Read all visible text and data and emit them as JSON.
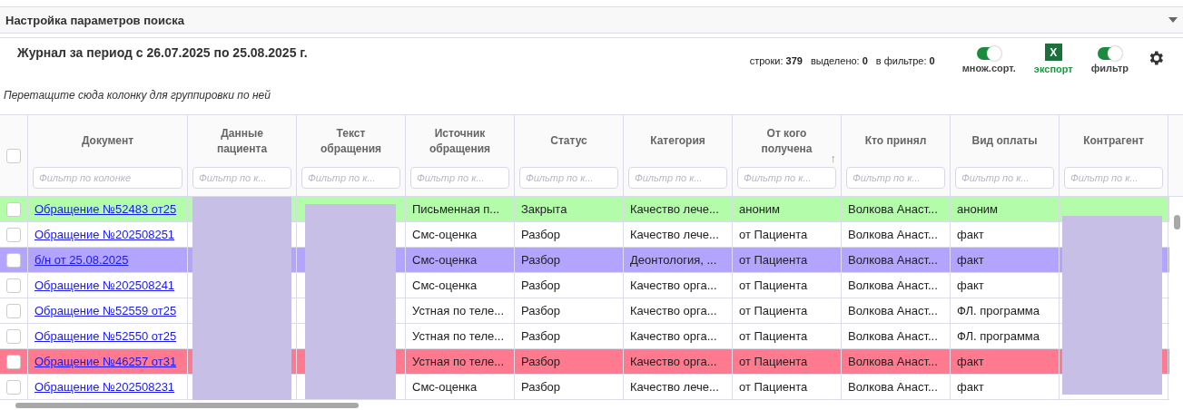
{
  "search_panel": {
    "title": "Настройка параметров поиска",
    "expanded": false
  },
  "journal": {
    "title": "Журнал за период с 26.07.2025 по 25.08.2025 г.",
    "stats": [
      {
        "label": "строки:",
        "value": "379"
      },
      {
        "label": "выделено:",
        "value": "0"
      },
      {
        "label": "в фильтре:",
        "value": "0"
      }
    ],
    "toggles": [
      {
        "label": "множ.сорт.",
        "on": true
      },
      {
        "kind": "export",
        "label": "экспорт",
        "icon_text": "X"
      },
      {
        "label": "фильтр",
        "on": true
      }
    ],
    "group_hint": "Перетащите сюда колонку для группировки по ней"
  },
  "table": {
    "select_all_checked": false,
    "columns": [
      {
        "title": "Документ",
        "filter_placeholder": "Фильтр по колонке",
        "kind": "link"
      },
      {
        "title": "Данные пациента",
        "filter_placeholder": "Фильтр по к..."
      },
      {
        "title": "Текст обращения",
        "filter_placeholder": "Фильтр по к..."
      },
      {
        "title": "Источник обращения",
        "filter_placeholder": "Фильтр по к..."
      },
      {
        "title": "Статус",
        "filter_placeholder": "Фильтр по к..."
      },
      {
        "title": "Категория",
        "filter_placeholder": "Фильтр по к..."
      },
      {
        "title": "От кого получена",
        "filter_placeholder": "Фильтр по к...",
        "sort_indicator": "↑"
      },
      {
        "title": "Кто принял",
        "filter_placeholder": "Фильтр по к..."
      },
      {
        "title": "Вид оплаты",
        "filter_placeholder": "Фильтр по к..."
      },
      {
        "title": "Контрагент",
        "filter_placeholder": "Фильтр по к..."
      }
    ],
    "rows": [
      {
        "checked": false,
        "color": "#b3fcaa",
        "cells": [
          "Обращение №52483 от25",
          "",
          "",
          "Письменная п...",
          "Закрыта",
          "Качество лече...",
          "аноним",
          "Волкова Анаст...",
          "аноним",
          ""
        ]
      },
      {
        "checked": false,
        "color": "#ffffff",
        "cells": [
          "Обращение №202508251",
          "",
          "",
          "Смс-оценка",
          "Разбор",
          "Качество лече...",
          "от Пациента",
          "Волкова Анаст...",
          "факт",
          ""
        ]
      },
      {
        "checked": false,
        "color": "#b3a4ff",
        "cells": [
          "б/н от 25.08.2025",
          "",
          "",
          "Смс-оценка",
          "Разбор",
          "Деонтология, ...",
          "от Пациента",
          "Волкова Анаст...",
          "факт",
          ""
        ]
      },
      {
        "checked": false,
        "color": "#ffffff",
        "cells": [
          "Обращение №202508241",
          "",
          "",
          "Смс-оценка",
          "Разбор",
          "Качество орга...",
          "от Пациента",
          "Волкова Анаст...",
          "факт",
          ""
        ]
      },
      {
        "checked": false,
        "color": "#ffffff",
        "cells": [
          "Обращение №52559 от25",
          "",
          "",
          "Устная по теле...",
          "Разбор",
          "Качество орга...",
          "от Пациента",
          "Волкова Анаст...",
          "ФЛ. программа",
          ""
        ]
      },
      {
        "checked": false,
        "color": "#ffffff",
        "cells": [
          "Обращение №52550 от25",
          "",
          "",
          "Устная по теле...",
          "Разбор",
          "Качество орга...",
          "от Пациента",
          "Волкова Анаст...",
          "ФЛ. программа",
          ""
        ]
      },
      {
        "checked": false,
        "color": "#ff7a8f",
        "cells": [
          "Обращение №46257 от31",
          "",
          "",
          "Устная по теле...",
          "Разбор",
          "Качество орга...",
          "от Пациента",
          "Волкова Анаст...",
          "факт",
          ""
        ]
      },
      {
        "checked": false,
        "color": "#ffffff",
        "cells": [
          "Обращение №202508231",
          "",
          "",
          "Смс-оценка",
          "Разбор",
          "Качество лече...",
          "от Пациента",
          "Волкова Анаст...",
          "факт",
          ""
        ]
      }
    ]
  }
}
